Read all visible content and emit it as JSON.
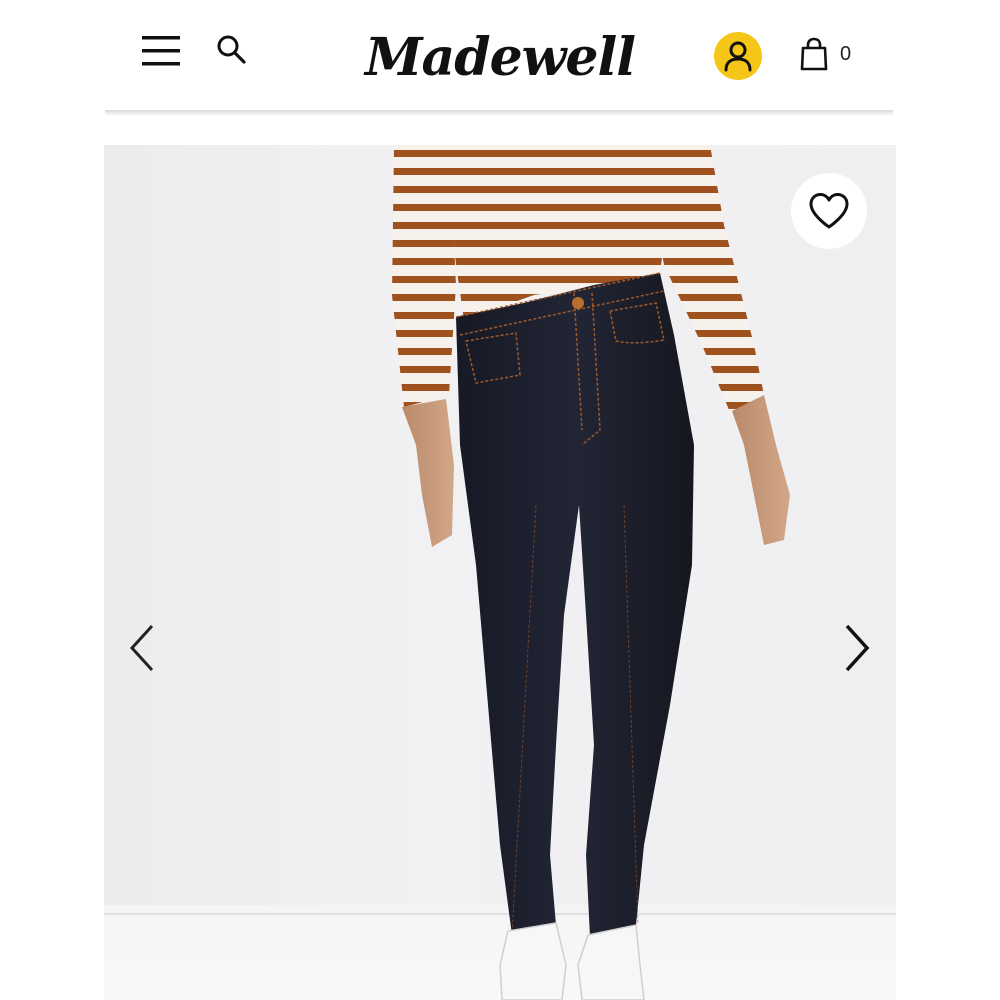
{
  "header": {
    "logo_text": "Madewell",
    "menu_icon": "hamburger-menu-icon",
    "search_icon": "search-icon",
    "account_icon": "user-icon",
    "account_color": "#F5C518",
    "cart_icon": "shopping-bag-icon",
    "cart_count": "0"
  },
  "product_gallery": {
    "favorite_icon": "heart-outline-icon",
    "prev_icon": "chevron-left-icon",
    "next_icon": "chevron-right-icon"
  },
  "colors": {
    "text": "#111111",
    "stripe": "#A0521E",
    "denim": "#1D1F2B",
    "background": "#EEEEF0"
  }
}
